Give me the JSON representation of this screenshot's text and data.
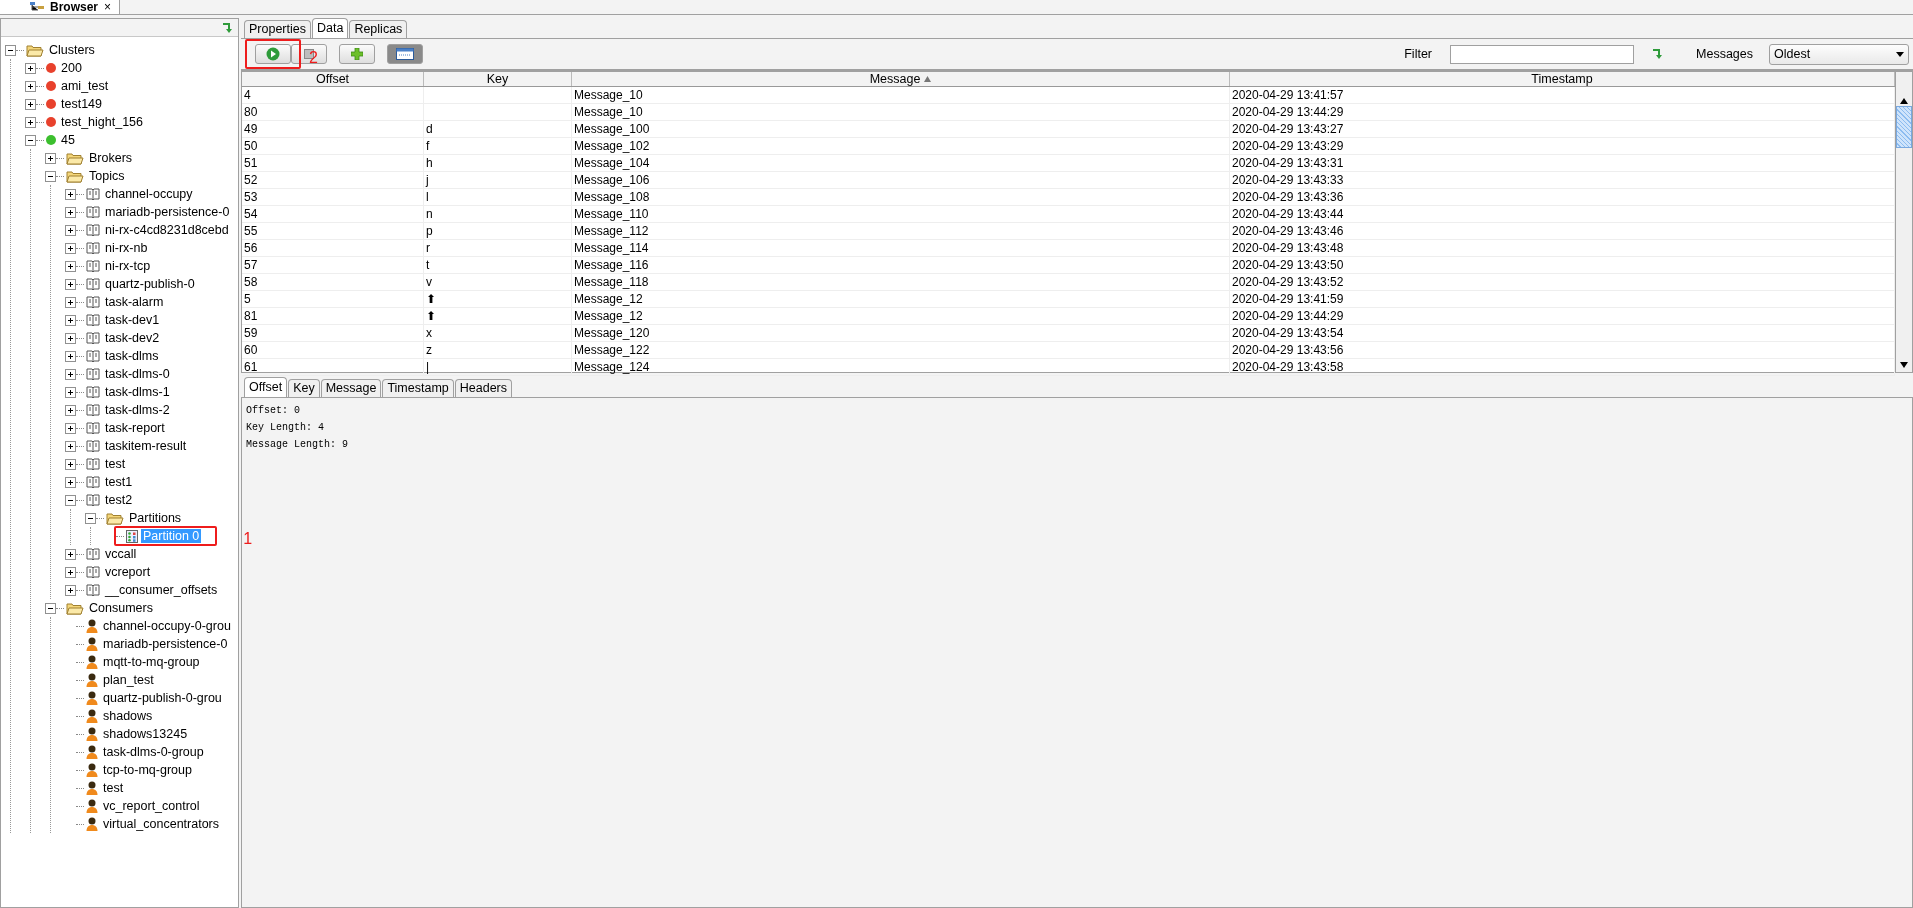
{
  "view_tab": {
    "title": "Browser",
    "close": "×"
  },
  "tree": [
    {
      "label": "Clusters",
      "kind": "folder",
      "expanded": true,
      "selected": false,
      "children": [
        {
          "label": "200",
          "kind": "cluster",
          "color": "#e8412c",
          "expanded": false,
          "selected": false
        },
        {
          "label": "ami_test",
          "kind": "cluster",
          "color": "#e8412c",
          "expanded": false,
          "selected": false
        },
        {
          "label": "test149",
          "kind": "cluster",
          "color": "#e8412c",
          "expanded": false,
          "selected": false
        },
        {
          "label": "test_hight_156",
          "kind": "cluster",
          "color": "#e8412c",
          "expanded": false,
          "selected": false
        },
        {
          "label": "45",
          "kind": "cluster",
          "color": "#3cbf2e",
          "expanded": true,
          "selected": false,
          "children": [
            {
              "label": "Brokers",
              "kind": "folder",
              "expanded": false,
              "selected": false
            },
            {
              "label": "Topics",
              "kind": "folder",
              "expanded": true,
              "selected": false,
              "children": [
                {
                  "label": "channel-occupy",
                  "kind": "topic",
                  "expanded": false,
                  "selected": false
                },
                {
                  "label": "mariadb-persistence-0",
                  "kind": "topic",
                  "expanded": false,
                  "selected": false
                },
                {
                  "label": "ni-rx-c4cd8231d8cebd",
                  "kind": "topic",
                  "expanded": false,
                  "selected": false
                },
                {
                  "label": "ni-rx-nb",
                  "kind": "topic",
                  "expanded": false,
                  "selected": false
                },
                {
                  "label": "ni-rx-tcp",
                  "kind": "topic",
                  "expanded": false,
                  "selected": false
                },
                {
                  "label": "quartz-publish-0",
                  "kind": "topic",
                  "expanded": false,
                  "selected": false
                },
                {
                  "label": "task-alarm",
                  "kind": "topic",
                  "expanded": false,
                  "selected": false
                },
                {
                  "label": "task-dev1",
                  "kind": "topic",
                  "expanded": false,
                  "selected": false
                },
                {
                  "label": "task-dev2",
                  "kind": "topic",
                  "expanded": false,
                  "selected": false
                },
                {
                  "label": "task-dlms",
                  "kind": "topic",
                  "expanded": false,
                  "selected": false
                },
                {
                  "label": "task-dlms-0",
                  "kind": "topic",
                  "expanded": false,
                  "selected": false
                },
                {
                  "label": "task-dlms-1",
                  "kind": "topic",
                  "expanded": false,
                  "selected": false
                },
                {
                  "label": "task-dlms-2",
                  "kind": "topic",
                  "expanded": false,
                  "selected": false
                },
                {
                  "label": "task-report",
                  "kind": "topic",
                  "expanded": false,
                  "selected": false
                },
                {
                  "label": "taskitem-result",
                  "kind": "topic",
                  "expanded": false,
                  "selected": false
                },
                {
                  "label": "test",
                  "kind": "topic",
                  "expanded": false,
                  "selected": false
                },
                {
                  "label": "test1",
                  "kind": "topic",
                  "expanded": false,
                  "selected": false
                },
                {
                  "label": "test2",
                  "kind": "topic",
                  "expanded": true,
                  "selected": false,
                  "children": [
                    {
                      "label": "Partitions",
                      "kind": "folder",
                      "expanded": true,
                      "selected": false,
                      "children": [
                        {
                          "label": "Partition 0",
                          "kind": "partition",
                          "selected": true,
                          "annotation": "1"
                        }
                      ]
                    }
                  ]
                },
                {
                  "label": "vccall",
                  "kind": "topic",
                  "expanded": false,
                  "selected": false
                },
                {
                  "label": "vcreport",
                  "kind": "topic",
                  "expanded": false,
                  "selected": false
                },
                {
                  "label": "__consumer_offsets",
                  "kind": "topic",
                  "expanded": false,
                  "selected": false
                }
              ]
            },
            {
              "label": "Consumers",
              "kind": "folder",
              "expanded": true,
              "selected": false,
              "children": [
                {
                  "label": "channel-occupy-0-grou",
                  "kind": "consumer",
                  "selected": false
                },
                {
                  "label": "mariadb-persistence-0",
                  "kind": "consumer",
                  "selected": false
                },
                {
                  "label": "mqtt-to-mq-group",
                  "kind": "consumer",
                  "selected": false
                },
                {
                  "label": "plan_test",
                  "kind": "consumer",
                  "selected": false
                },
                {
                  "label": "quartz-publish-0-grou",
                  "kind": "consumer",
                  "selected": false
                },
                {
                  "label": "shadows",
                  "kind": "consumer",
                  "selected": false
                },
                {
                  "label": "shadows13245",
                  "kind": "consumer",
                  "selected": false
                },
                {
                  "label": "task-dlms-0-group",
                  "kind": "consumer",
                  "selected": false
                },
                {
                  "label": "tcp-to-mq-group",
                  "kind": "consumer",
                  "selected": false
                },
                {
                  "label": "test",
                  "kind": "consumer",
                  "selected": false
                },
                {
                  "label": "vc_report_control",
                  "kind": "consumer",
                  "selected": false
                },
                {
                  "label": "virtual_concentrators",
                  "kind": "consumer",
                  "selected": false
                }
              ]
            }
          ]
        }
      ]
    }
  ],
  "tabs": [
    {
      "label": "Properties",
      "selected": false
    },
    {
      "label": "Data",
      "selected": true
    },
    {
      "label": "Replicas",
      "selected": false
    }
  ],
  "toolbar": [
    {
      "kind": "play",
      "disabled": false,
      "pressed": false,
      "annotation": "2"
    },
    {
      "kind": "stop",
      "disabled": true,
      "pressed": false
    },
    {
      "kind": "add",
      "disabled": false,
      "pressed": false
    },
    {
      "kind": "view",
      "disabled": false,
      "pressed": true
    }
  ],
  "filter": {
    "label": "Filter"
  },
  "messages_select": {
    "label": "Messages",
    "value": "Oldest"
  },
  "table": {
    "columns": [
      {
        "label": "Offset",
        "sorted": false
      },
      {
        "label": "Key",
        "sorted": false
      },
      {
        "label": "Message",
        "sorted": true
      },
      {
        "label": "Timestamp",
        "sorted": false
      }
    ],
    "rows": [
      [
        "4",
        "",
        "Message_10",
        "2020-04-29 13:41:57"
      ],
      [
        "80",
        "",
        "Message_10",
        "2020-04-29 13:44:29"
      ],
      [
        "49",
        "d",
        "Message_100",
        "2020-04-29 13:43:27"
      ],
      [
        "50",
        "f",
        "Message_102",
        "2020-04-29 13:43:29"
      ],
      [
        "51",
        "h",
        "Message_104",
        "2020-04-29 13:43:31"
      ],
      [
        "52",
        "j",
        "Message_106",
        "2020-04-29 13:43:33"
      ],
      [
        "53",
        "l",
        "Message_108",
        "2020-04-29 13:43:36"
      ],
      [
        "54",
        "n",
        "Message_110",
        "2020-04-29 13:43:44"
      ],
      [
        "55",
        "p",
        "Message_112",
        "2020-04-29 13:43:46"
      ],
      [
        "56",
        "r",
        "Message_114",
        "2020-04-29 13:43:48"
      ],
      [
        "57",
        "t",
        "Message_116",
        "2020-04-29 13:43:50"
      ],
      [
        "58",
        "v",
        "Message_118",
        "2020-04-29 13:43:52"
      ],
      [
        "5",
        "⬆",
        "Message_12",
        "2020-04-29 13:41:59"
      ],
      [
        "81",
        "⬆",
        "Message_12",
        "2020-04-29 13:44:29"
      ],
      [
        "59",
        "x",
        "Message_120",
        "2020-04-29 13:43:54"
      ],
      [
        "60",
        "z",
        "Message_122",
        "2020-04-29 13:43:56"
      ],
      [
        "61",
        "|",
        "Message_124",
        "2020-04-29 13:43:58"
      ]
    ]
  },
  "detail_tabs": [
    {
      "label": "Offset",
      "selected": true
    },
    {
      "label": "Key",
      "selected": false
    },
    {
      "label": "Message",
      "selected": false
    },
    {
      "label": "Timestamp",
      "selected": false
    },
    {
      "label": "Headers",
      "selected": false
    }
  ],
  "detail_lines": [
    "Offset: 0",
    "Key Length: 4",
    "Message Length: 9"
  ]
}
